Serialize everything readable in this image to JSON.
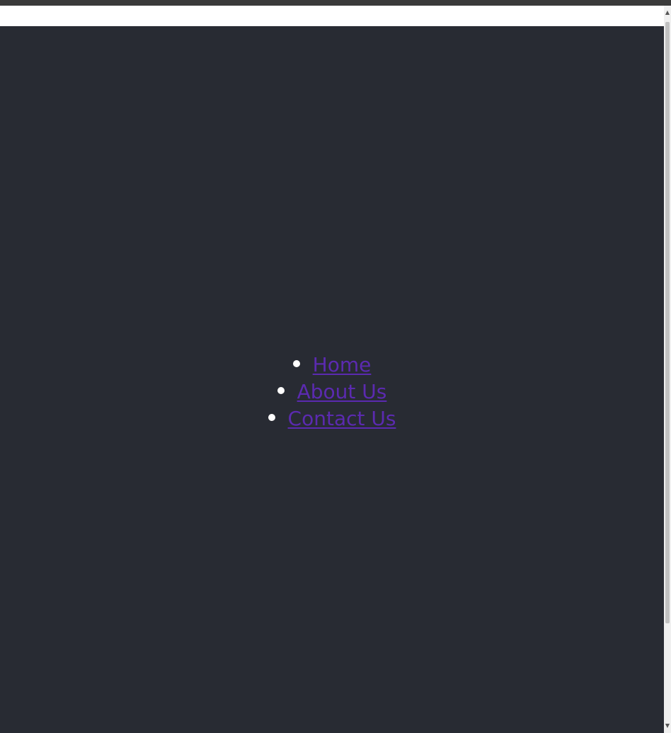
{
  "nav": {
    "items": [
      {
        "label": "Home"
      },
      {
        "label": "About Us"
      },
      {
        "label": "Contact Us"
      }
    ]
  },
  "colors": {
    "background": "#282b33",
    "link": "#5b2ab0",
    "bullet": "#ffffff"
  },
  "icons": {
    "scroll_up": "chevron-up-icon",
    "scroll_down": "chevron-down-icon"
  }
}
